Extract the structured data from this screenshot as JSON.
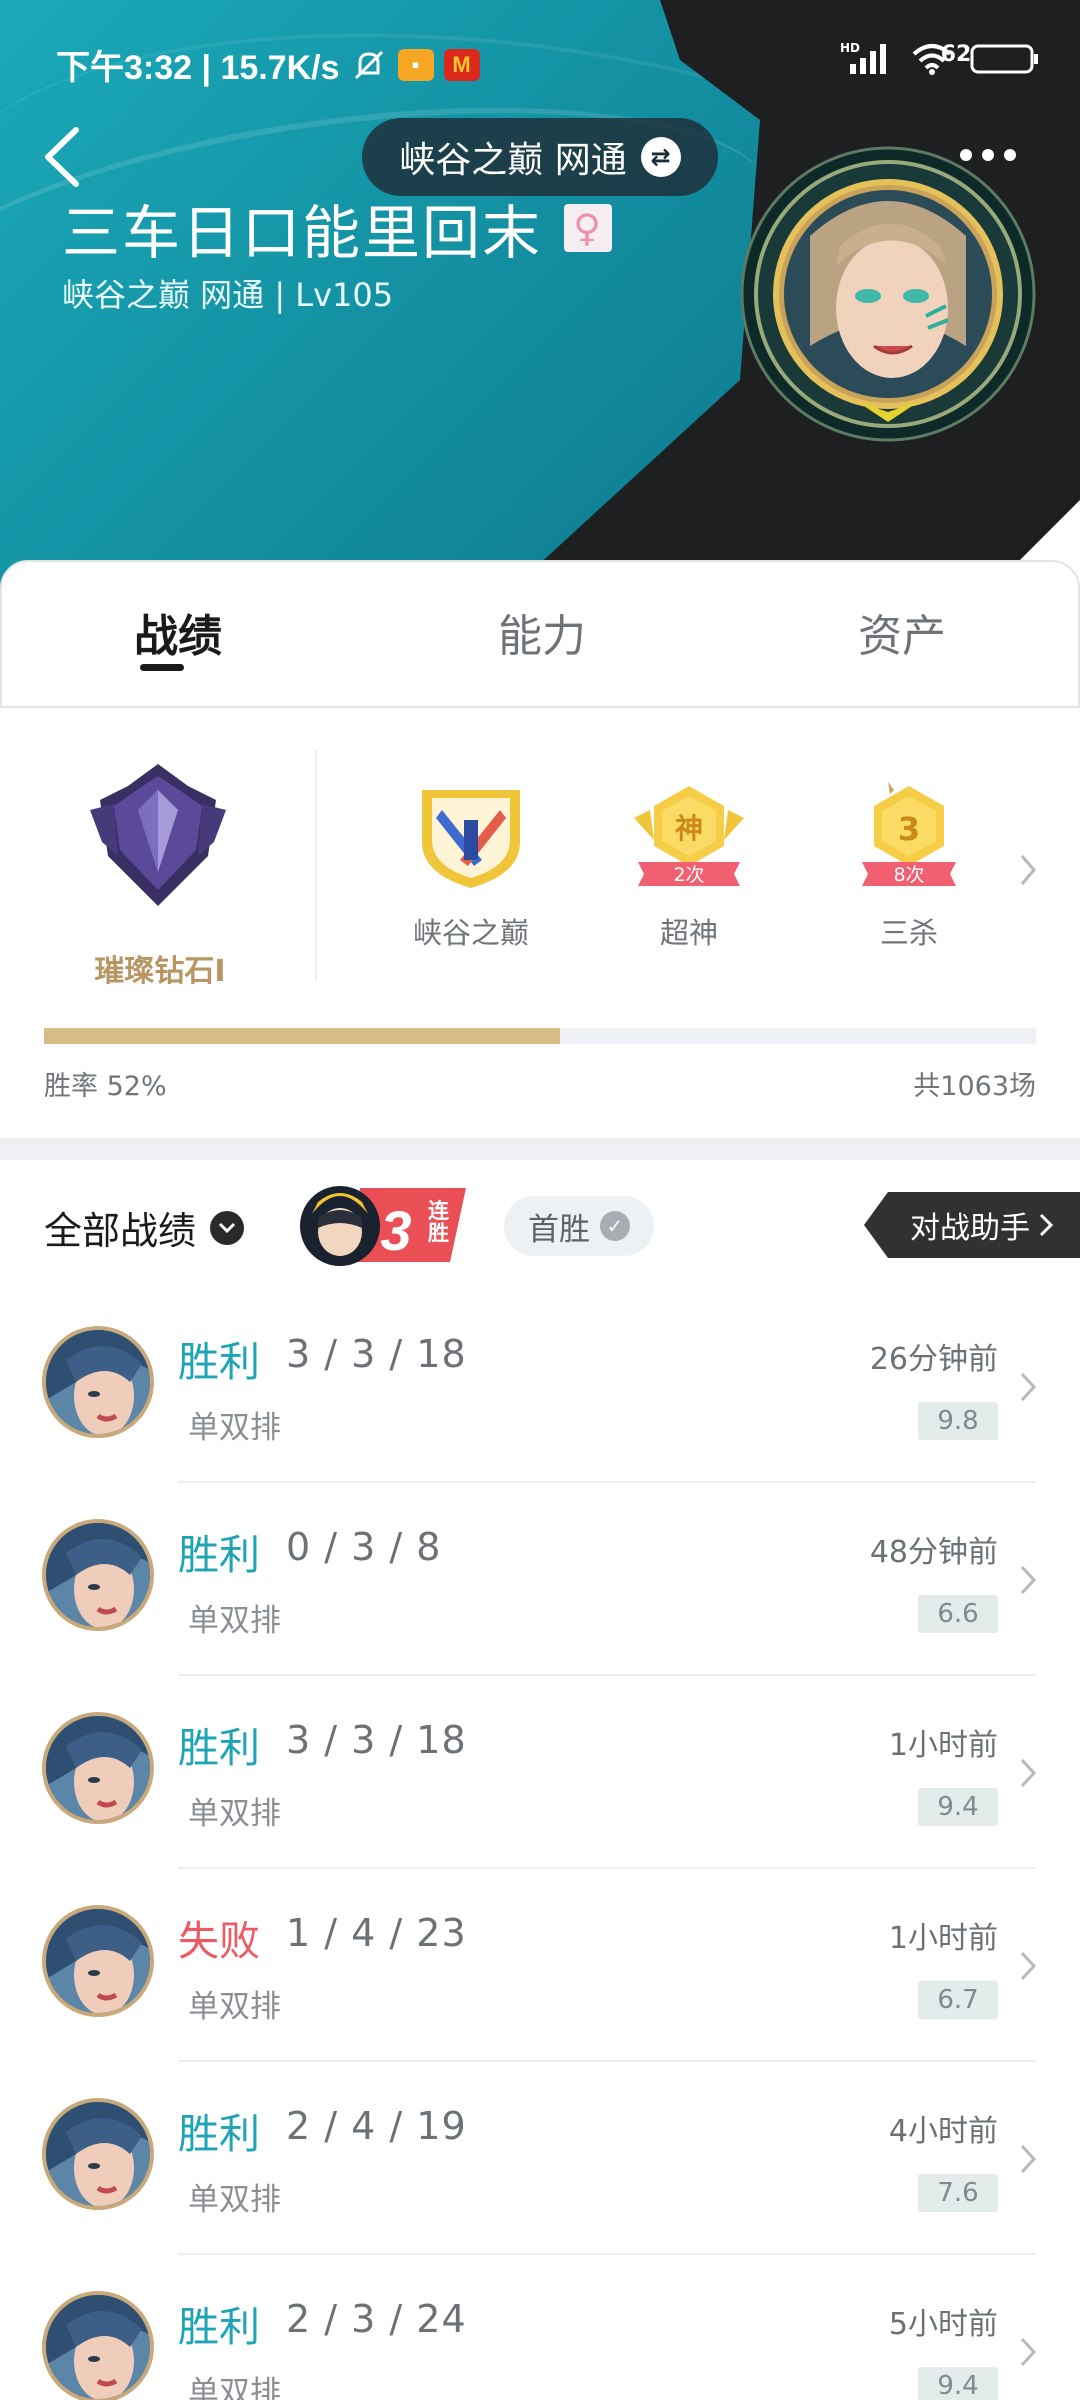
{
  "status_bar": {
    "time_speed": "下午3:32 | 15.7K/s",
    "battery": "62"
  },
  "header": {
    "server_selector": "峡谷之巅 网通",
    "player_name": "三车日口能里回末",
    "player_sub": "峡谷之巅 网通 | Lv105"
  },
  "tabs": [
    {
      "label": "战绩",
      "active": true
    },
    {
      "label": "能力",
      "active": false
    },
    {
      "label": "资产",
      "active": false
    }
  ],
  "rank": {
    "tier": "璀璨钻石I",
    "badges": [
      {
        "label": "峡谷之巅",
        "count": ""
      },
      {
        "label": "超神",
        "count": "2次",
        "glyph": "神"
      },
      {
        "label": "三杀",
        "count": "8次",
        "glyph": "3"
      }
    ],
    "win_rate_text": "胜率   52%",
    "win_rate": 0.52,
    "total_games": "共1063场"
  },
  "records": {
    "filter_label": "全部战绩",
    "streak_text": "3",
    "streak_sub": "连胜",
    "first_win_label": "首胜",
    "assistant_label": "对战助手"
  },
  "matches": [
    {
      "result": "胜利",
      "outcome": "win",
      "kda": "3 / 3 / 18",
      "mode": "单双排",
      "time": "26分钟前",
      "score": "9.8"
    },
    {
      "result": "胜利",
      "outcome": "win",
      "kda": "0 / 3 / 8",
      "mode": "单双排",
      "time": "48分钟前",
      "score": "6.6"
    },
    {
      "result": "胜利",
      "outcome": "win",
      "kda": "3 / 3 / 18",
      "mode": "单双排",
      "time": "1小时前",
      "score": "9.4"
    },
    {
      "result": "失败",
      "outcome": "lose",
      "kda": "1 / 4 / 23",
      "mode": "单双排",
      "time": "1小时前",
      "score": "6.7"
    },
    {
      "result": "胜利",
      "outcome": "win",
      "kda": "2 / 4 / 19",
      "mode": "单双排",
      "time": "4小时前",
      "score": "7.6"
    },
    {
      "result": "胜利",
      "outcome": "win",
      "kda": "2 / 3 / 24",
      "mode": "单双排",
      "time": "5小时前",
      "score": "9.4"
    }
  ],
  "colors": {
    "win": "#1ea4b5",
    "lose": "#ec5b63",
    "rank_gold": "#b89664",
    "header_teal": "#138fa1"
  }
}
